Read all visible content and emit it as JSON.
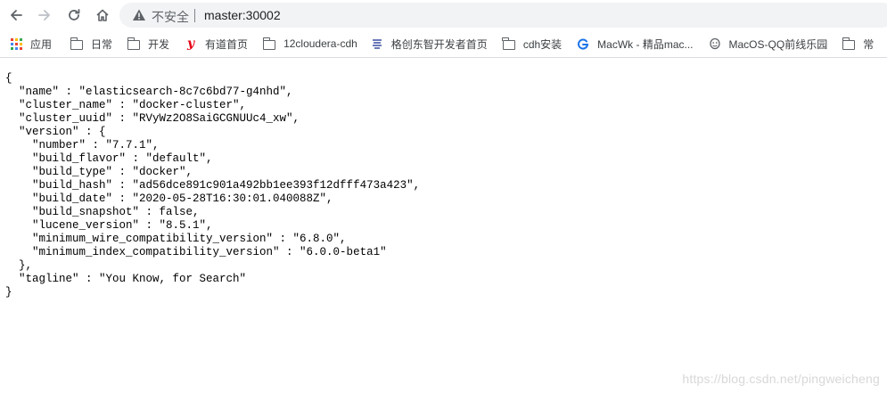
{
  "toolbar": {
    "back_icon": "arrow-left",
    "forward_icon": "arrow-right",
    "reload_icon": "reload",
    "home_icon": "home",
    "security_label": "不安全",
    "url": "master:30002"
  },
  "bookmarks": [
    {
      "label": "应用",
      "icon": "apps-grid-icon"
    },
    {
      "label": "日常",
      "icon": "folder-icon"
    },
    {
      "label": "开发",
      "icon": "folder-icon"
    },
    {
      "label": "有道首页",
      "icon": "youdao-icon"
    },
    {
      "label": "12cloudera-cdh",
      "icon": "folder-icon"
    },
    {
      "label": "格创东智开发者首页",
      "icon": "gechuang-icon"
    },
    {
      "label": "cdh安装",
      "icon": "folder-icon"
    },
    {
      "label": "MacWk - 精品mac...",
      "icon": "macwk-icon"
    },
    {
      "label": "MacOS-QQ前线乐园",
      "icon": "qq-icon"
    },
    {
      "label": "常",
      "icon": "folder-icon"
    }
  ],
  "colors": {
    "youdao": "#e60012",
    "macwk": "#1a73e8",
    "watermark": "#d8d8d8"
  },
  "json_lines": [
    "{",
    "  \"name\" : \"elasticsearch-8c7c6bd77-g4nhd\",",
    "  \"cluster_name\" : \"docker-cluster\",",
    "  \"cluster_uuid\" : \"RVyWz2O8SaiGCGNUUc4_xw\",",
    "  \"version\" : {",
    "    \"number\" : \"7.7.1\",",
    "    \"build_flavor\" : \"default\",",
    "    \"build_type\" : \"docker\",",
    "    \"build_hash\" : \"ad56dce891c901a492bb1ee393f12dfff473a423\",",
    "    \"build_date\" : \"2020-05-28T16:30:01.040088Z\",",
    "    \"build_snapshot\" : false,",
    "    \"lucene_version\" : \"8.5.1\",",
    "    \"minimum_wire_compatibility_version\" : \"6.8.0\",",
    "    \"minimum_index_compatibility_version\" : \"6.0.0-beta1\"",
    "  },",
    "  \"tagline\" : \"You Know, for Search\"",
    "}"
  ],
  "watermark": "https://blog.csdn.net/pingweicheng"
}
